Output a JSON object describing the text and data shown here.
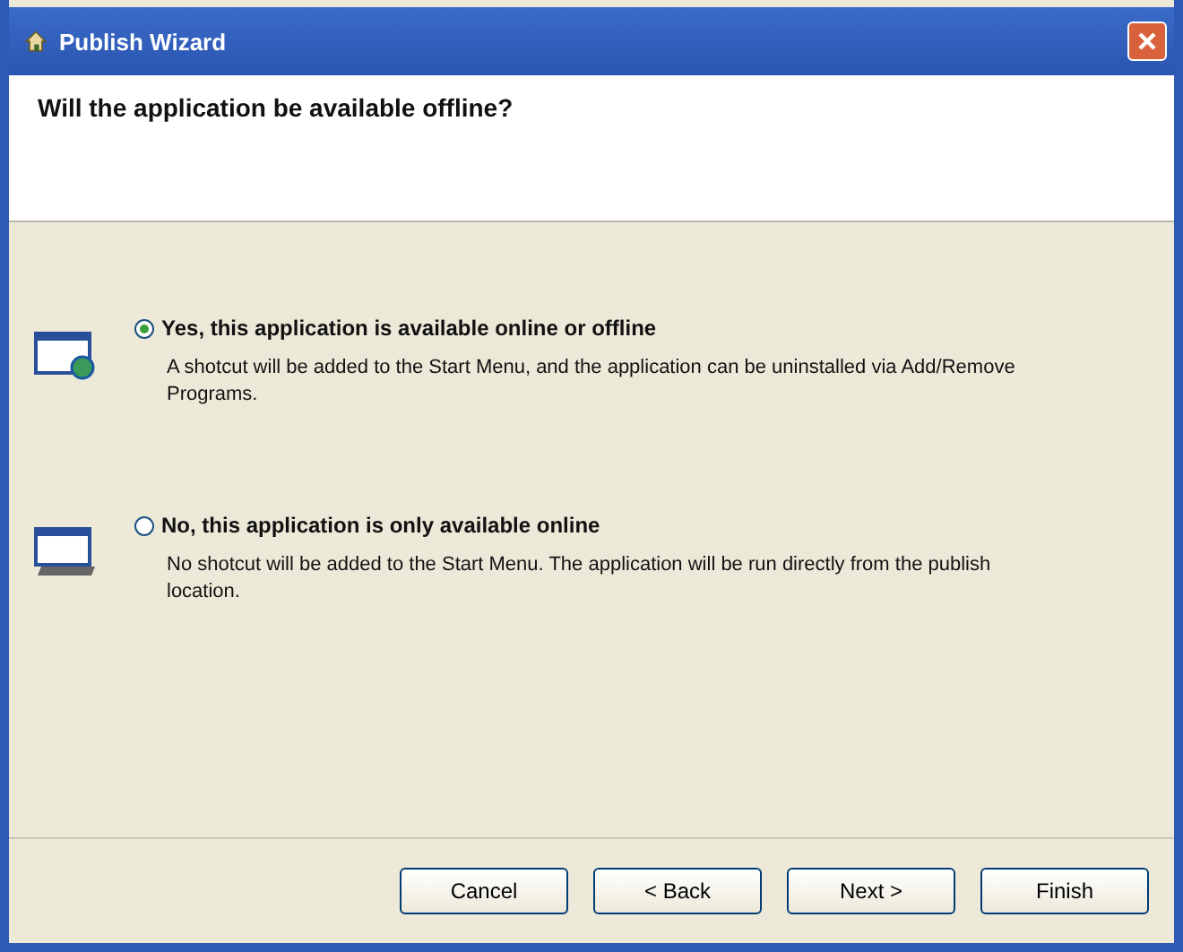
{
  "window": {
    "title": "Publish Wizard"
  },
  "header": {
    "question": "Will the application be available offline?"
  },
  "options": [
    {
      "kind": "offline",
      "label": "Yes, this application is available online or offline",
      "description": "A shotcut will be added to the Start Menu, and the application can be uninstalled via Add/Remove Programs.",
      "selected": true
    },
    {
      "kind": "online",
      "label": "No, this application is only available online",
      "description": "No shotcut will be added to the Start Menu. The application will be run directly from the publish location.",
      "selected": false
    }
  ],
  "buttons": [
    "Cancel",
    "< Back",
    "Next >",
    "Finish"
  ]
}
